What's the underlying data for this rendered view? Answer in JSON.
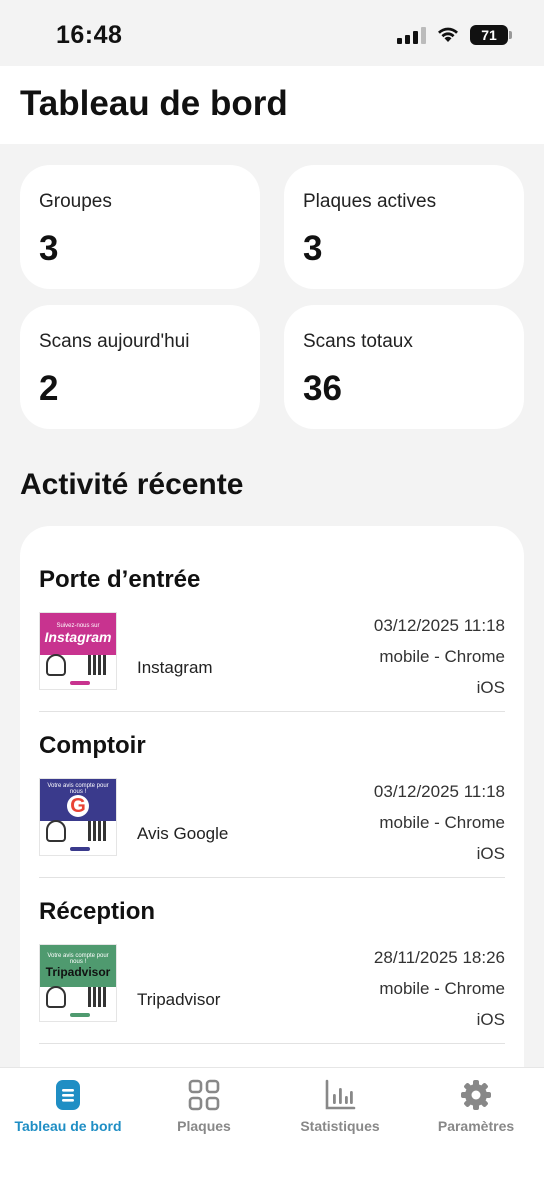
{
  "status": {
    "time": "16:48",
    "battery": "71"
  },
  "header": {
    "title": "Tableau de bord"
  },
  "stats": [
    {
      "label": "Groupes",
      "value": "3"
    },
    {
      "label": "Plaques actives",
      "value": "3"
    },
    {
      "label": "Scans aujourd'hui",
      "value": "2"
    },
    {
      "label": "Scans totaux",
      "value": "36"
    }
  ],
  "activity": {
    "title": "Activité récente",
    "items": [
      {
        "title": "Porte d’entrée",
        "source": "Instagram",
        "datetime": "03/12/2025 11:18",
        "device": "mobile - Chrome",
        "os": "iOS",
        "thumb": {
          "header": "Suivez-nous sur",
          "brand": "Instagram",
          "color": "#c8338f"
        }
      },
      {
        "title": "Comptoir",
        "source": "Avis Google",
        "datetime": "03/12/2025 11:18",
        "device": "mobile - Chrome",
        "os": "iOS",
        "thumb": {
          "header": "Votre avis compte pour nous !",
          "brand": "G",
          "color": "#3a3a8c"
        }
      },
      {
        "title": "Réception",
        "source": "Tripadvisor",
        "datetime": "28/11/2025 18:26",
        "device": "mobile - Chrome",
        "os": "iOS",
        "thumb": {
          "header": "Votre avis compte pour nous !",
          "brand": "Tripadvisor",
          "color": "#4f9a6f"
        }
      }
    ]
  },
  "nav": [
    {
      "label": "Tableau de bord",
      "icon": "document-icon",
      "active": true
    },
    {
      "label": "Plaques",
      "icon": "grid-icon",
      "active": false
    },
    {
      "label": "Statistiques",
      "icon": "chart-icon",
      "active": false
    },
    {
      "label": "Paramètres",
      "icon": "gear-icon",
      "active": false
    }
  ],
  "colors": {
    "accent": "#1f8ec4",
    "background": "#f3f3f3",
    "card": "#ffffff"
  }
}
